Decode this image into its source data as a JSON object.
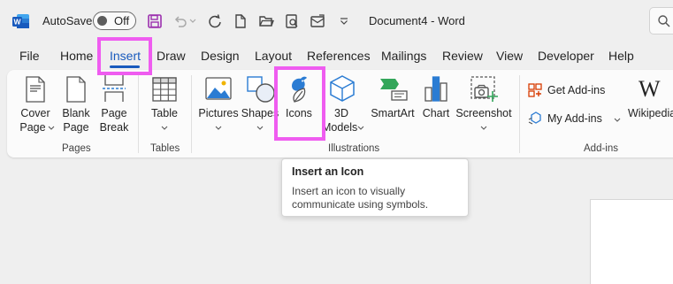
{
  "titlebar": {
    "app_icon": "word-logo-icon",
    "autosave_label": "AutoSave",
    "autosave_state": "Off",
    "document_title": "Document4",
    "separator": "-",
    "app_name": "Word",
    "qat_icons": [
      "save-icon",
      "undo-icon",
      "redo-icon",
      "repeat-icon",
      "new-document-icon",
      "open-folder-icon",
      "email-icon",
      "customize-qat-icon"
    ]
  },
  "tabs": [
    "File",
    "Home",
    "Insert",
    "Draw",
    "Design",
    "Layout",
    "References",
    "Mailings",
    "Review",
    "View",
    "Developer",
    "Help"
  ],
  "active_tab": "Insert",
  "ribbon": {
    "pages": {
      "label": "Pages",
      "cover_page": [
        "Cover",
        "Page"
      ],
      "blank_page": [
        "Blank",
        "Page"
      ],
      "page_break": [
        "Page",
        "Break"
      ]
    },
    "tables": {
      "label": "Tables",
      "table": "Table"
    },
    "illustrations": {
      "label": "Illustrations",
      "pictures": "Pictures",
      "shapes": "Shapes",
      "icons": "Icons",
      "models": [
        "3D",
        "Models"
      ],
      "smartart": "SmartArt",
      "chart": "Chart",
      "screenshot": "Screenshot"
    },
    "addins": {
      "label": "Add-ins",
      "get_addins": "Get Add-ins",
      "my_addins": "My Add-ins",
      "wikipedia": "Wikipedia"
    }
  },
  "tooltip": {
    "title": "Insert an Icon",
    "body": "Insert an icon to visually communicate using symbols."
  },
  "colors": {
    "accent": "#185abd",
    "highlight": "#ef5cf0",
    "word_blue": "#185abd",
    "save_purple": "#a4262c"
  }
}
